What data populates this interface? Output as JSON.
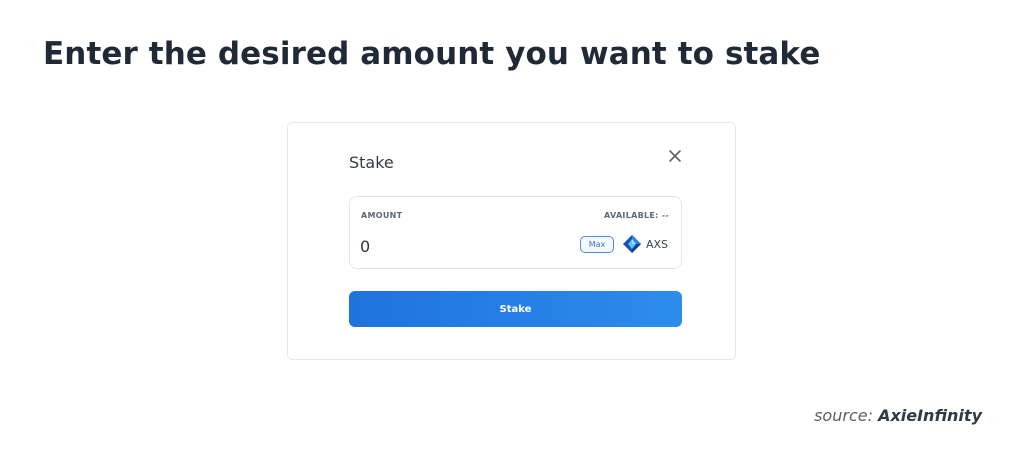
{
  "headline": "Enter the desired amount you want to stake",
  "modal": {
    "title": "Stake",
    "close_icon": "close-icon",
    "amount_label": "AMOUNT",
    "available_label": "AVAILABLE: --",
    "amount_value": "0",
    "max_label": "Max",
    "token_icon": "axs-token-icon",
    "token_symbol": "AXS",
    "stake_button_label": "Stake",
    "accent_color": "#2181e6"
  },
  "source": {
    "prefix": "source: ",
    "brand": "AxieInfinity"
  }
}
